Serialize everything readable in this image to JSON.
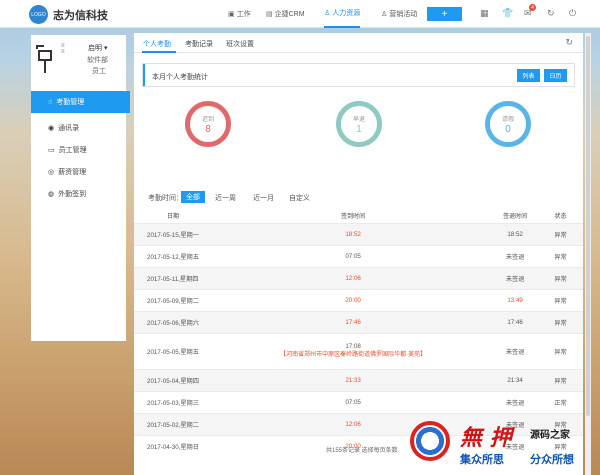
{
  "brand": {
    "logo_text": "LOGO",
    "name": "志为信科技"
  },
  "topnav": [
    {
      "label": "工作",
      "icon": "briefcase-icon"
    },
    {
      "label": "企捷CRM",
      "icon": "crm-icon"
    },
    {
      "label": "人力资源",
      "icon": "people-icon"
    },
    {
      "label": "营销活动",
      "icon": "campaign-icon"
    }
  ],
  "top_actions": {
    "plus": "+",
    "mail_badge": "4"
  },
  "user": {
    "name": "启明",
    "dept": "软件部",
    "role": "员工"
  },
  "sidebar": [
    {
      "label": "考勤管理",
      "icon": "hand-icon",
      "active": true
    },
    {
      "label": "通讯录",
      "icon": "contacts-icon"
    },
    {
      "label": "员工管理",
      "icon": "staff-icon"
    },
    {
      "label": "薪资管理",
      "icon": "salary-icon"
    },
    {
      "label": "外勤签到",
      "icon": "location-icon"
    }
  ],
  "tabs": [
    "个人考勤",
    "考勤记录",
    "班次设置"
  ],
  "stats": {
    "title": "本月个人考勤统计",
    "btn_list": "列表",
    "btn_calendar": "日历",
    "late": {
      "label": "迟到",
      "value": "8",
      "color": "#e06a6a"
    },
    "early": {
      "label": "早退",
      "value": "1",
      "color": "#8ec9c2"
    },
    "leave": {
      "label": "请假",
      "value": "0",
      "color": "#5ab4e6"
    }
  },
  "filter": {
    "label": "考勤时间：",
    "options": [
      "全部",
      "近一周",
      "近一月",
      "自定义"
    ]
  },
  "table": {
    "headers": [
      "日期",
      "签到时间",
      "签退时间",
      "状态"
    ],
    "rows": [
      {
        "date": "2017-05-15,星期一",
        "in": "18:52",
        "out": "18:52",
        "status": "异常",
        "in_red": true,
        "out_red": false
      },
      {
        "date": "2017-05-12,星期五",
        "in": "07:05",
        "out": "未签退",
        "status": "异常",
        "in_red": false,
        "out_red": false
      },
      {
        "date": "2017-05-11,星期四",
        "in": "12:06",
        "out": "未签退",
        "status": "异常",
        "in_red": true,
        "out_red": false
      },
      {
        "date": "2017-05-09,星期二",
        "in": "20:00",
        "out": "13:49",
        "status": "异常",
        "in_red": true,
        "out_red": true
      },
      {
        "date": "2017-05-06,星期六",
        "in": "17:46",
        "out": "17:46",
        "status": "异常",
        "in_red": true,
        "out_red": false
      },
      {
        "date": "2017-05-05,星期五",
        "in": "17:08",
        "in_addr": "【河南省郑州市中原区秦岭路街道佛罗国际华都·美苑】",
        "out": "未签退",
        "status": "异常",
        "in_red": false,
        "out_red": false
      },
      {
        "date": "2017-05-04,星期四",
        "in": "21:33",
        "out": "21:34",
        "status": "异常",
        "in_red": true,
        "out_red": false
      },
      {
        "date": "2017-05-03,星期三",
        "in": "07:05",
        "out": "未签退",
        "status": "正常",
        "in_red": false,
        "out_red": false
      },
      {
        "date": "2017-05-02,星期二",
        "in": "12:06",
        "out": "未签退",
        "status": "异常",
        "in_red": true,
        "out_red": false
      },
      {
        "date": "2017-04-30,星期日",
        "in": "20:00",
        "out": "未签退",
        "status": "异常",
        "in_red": true,
        "out_red": false
      }
    ]
  },
  "footer": "共155条记录 选择每页条数",
  "watermark": {
    "big": "無 押",
    "site": "源码之家",
    "slogan1": "集众所思",
    "slogan2": "分众所想"
  }
}
